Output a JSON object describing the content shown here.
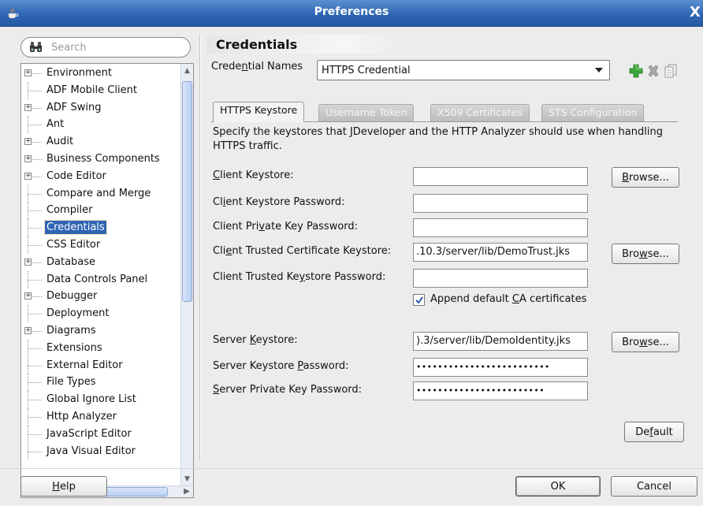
{
  "window": {
    "title": "Preferences",
    "close_glyph": "X"
  },
  "search": {
    "placeholder": "Search"
  },
  "tree": {
    "items": [
      {
        "label": "Environment",
        "expandable": true
      },
      {
        "label": "ADF Mobile Client",
        "expandable": false
      },
      {
        "label": "ADF Swing",
        "expandable": true
      },
      {
        "label": "Ant",
        "expandable": false
      },
      {
        "label": "Audit",
        "expandable": true
      },
      {
        "label": "Business Components",
        "expandable": true
      },
      {
        "label": "Code Editor",
        "expandable": true
      },
      {
        "label": "Compare and Merge",
        "expandable": false
      },
      {
        "label": "Compiler",
        "expandable": false
      },
      {
        "label": "Credentials",
        "expandable": false,
        "selected": true
      },
      {
        "label": "CSS Editor",
        "expandable": false
      },
      {
        "label": "Database",
        "expandable": true
      },
      {
        "label": "Data Controls Panel",
        "expandable": false
      },
      {
        "label": "Debugger",
        "expandable": true
      },
      {
        "label": "Deployment",
        "expandable": false
      },
      {
        "label": "Diagrams",
        "expandable": true
      },
      {
        "label": "Extensions",
        "expandable": false
      },
      {
        "label": "External Editor",
        "expandable": false
      },
      {
        "label": "File Types",
        "expandable": false
      },
      {
        "label": "Global Ignore List",
        "expandable": false
      },
      {
        "label": "Http Analyzer",
        "expandable": false
      },
      {
        "label": "JavaScript Editor",
        "expandable": false
      },
      {
        "label": "Java Visual Editor",
        "expandable": false
      }
    ]
  },
  "page": {
    "title": "Credentials",
    "credential_names_label_pre": "Crede",
    "credential_names_label_mn": "n",
    "credential_names_label_post": "tial Names",
    "credential_selected": "HTTPS Credential"
  },
  "toolbar_icons": [
    "add-icon",
    "delete-icon",
    "copy-icon"
  ],
  "tabs": [
    {
      "label": "HTTPS Keystore",
      "active": true
    },
    {
      "label": "Username Token",
      "active": false
    },
    {
      "label": "X509 Certificates",
      "active": false
    },
    {
      "label": "STS Configuration",
      "active": false
    }
  ],
  "description": "Specify the keystores that JDeveloper and the HTTP Analyzer should use when handling HTTPS traffic.",
  "fields": {
    "client_keystore": {
      "label": "Client Keystore:",
      "value": ""
    },
    "client_keystore_password": {
      "label": "Client Keystore Password:",
      "value": ""
    },
    "client_private_key_password": {
      "label": "Client Private Key Password:",
      "value": ""
    },
    "client_trusted_cert_keystore": {
      "label": "Client Trusted Certificate Keystore:",
      "value": ".10.3/server/lib/DemoTrust.jks"
    },
    "client_trusted_keystore_password": {
      "label": "Client Trusted Keystore Password:",
      "value": ""
    },
    "append_ca": {
      "label": "Append default CA certificates",
      "checked": true
    },
    "server_keystore": {
      "label": "Server Keystore:",
      "value": ").3/server/lib/DemoIdentity.jks"
    },
    "server_keystore_password": {
      "label": "Server Keystore Password:",
      "value": "•••••••••••••••••••••••••"
    },
    "server_private_key_password": {
      "label": "Server Private Key Password:",
      "value": "••••••••••••••••••••••••"
    }
  },
  "buttons": {
    "browse": "Browse...",
    "default": "Default",
    "help": "Help",
    "ok": "OK",
    "cancel": "Cancel"
  },
  "colors": {
    "titlebar": "#2f66b3",
    "selection": "#2f64b4",
    "add_icon": "#3aa63a"
  }
}
